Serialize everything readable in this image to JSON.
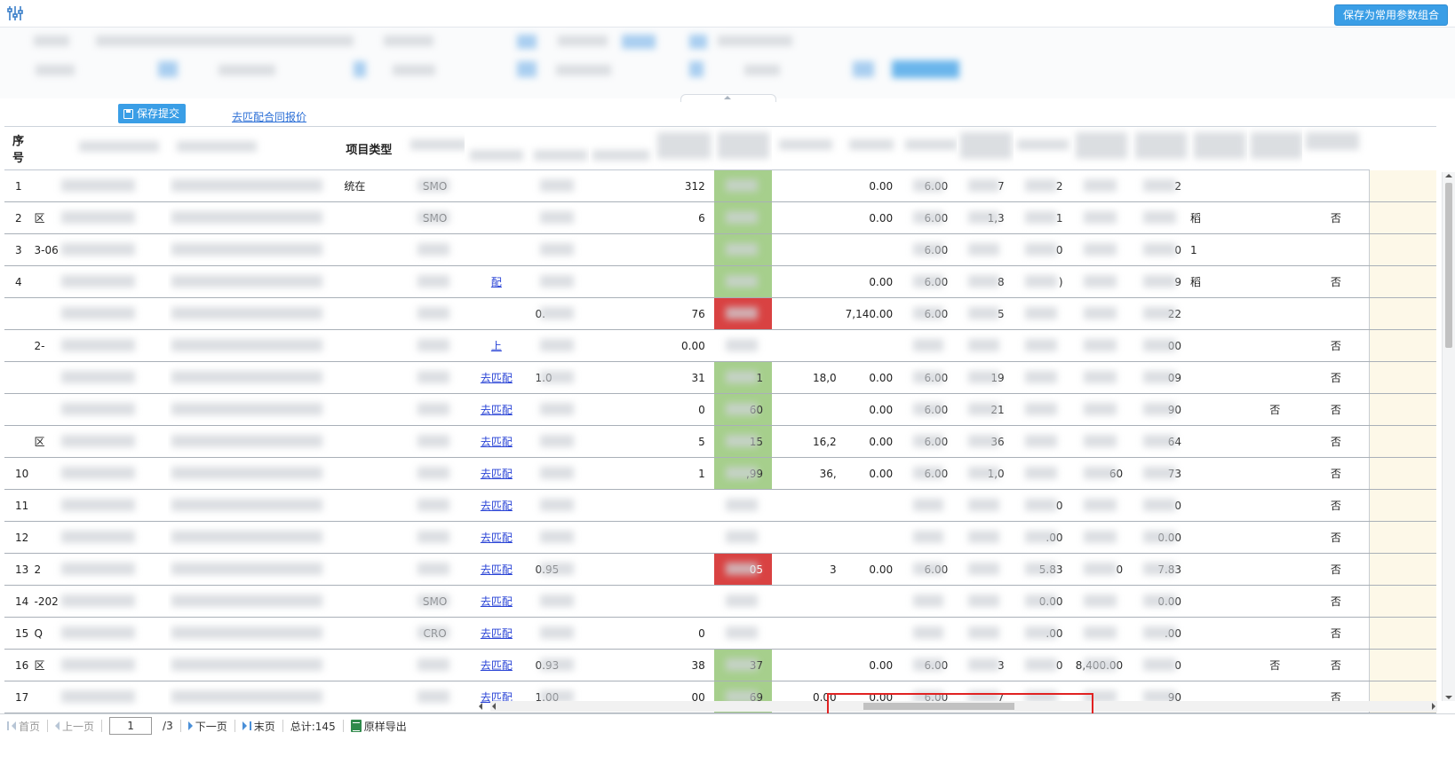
{
  "toolbar": {
    "filter_icon": "sliders-icon",
    "save_combo_label": "保存为常用参数组合"
  },
  "actions": {
    "save_submit_label": "保存提交",
    "match_contract_link": "去匹配合同报价"
  },
  "table": {
    "headers": {
      "index": "序号",
      "project_type": "项目类型"
    },
    "rows": [
      {
        "idx": "1",
        "c1": "",
        "c3": "统在",
        "type": "SMO",
        "match": "",
        "c5": "",
        "c7": "312",
        "c8": "",
        "c9": "",
        "c10": "0.00",
        "c11": "6.00",
        "c12": "7",
        "c13": "2",
        "c14": "",
        "c15": "2",
        "c16": "",
        "c17": "",
        "c18": "",
        "green": true,
        "red": false
      },
      {
        "idx": "2",
        "c1": "区",
        "c3": "",
        "type": "SMO",
        "match": "",
        "c5": "",
        "c7": "6",
        "c8": "",
        "c9": "",
        "c10": "0.00",
        "c11": "6.00",
        "c12": "1,3",
        "c13": "1",
        "c14": "",
        "c15": "",
        "c16": "稻",
        "c17": "",
        "c18": "否",
        "green": true,
        "red": false
      },
      {
        "idx": "3",
        "c1": "3-06",
        "c3": "",
        "type": "",
        "match": "",
        "c5": "",
        "c7": "",
        "c8": "",
        "c9": "",
        "c10": "",
        "c11": "6.00",
        "c12": "",
        "c13": "0",
        "c14": "",
        "c15": "0",
        "c16": "1",
        "c17": "",
        "c18": "",
        "green": true,
        "red": false
      },
      {
        "idx": "4",
        "c1": "",
        "c3": "",
        "type": "",
        "match": "配",
        "c5": "",
        "c7": "",
        "c8": "",
        "c9": "",
        "c10": "0.00",
        "c11": "6.00",
        "c12": "8",
        "c13": ")",
        "c14": "",
        "c15": "9",
        "c16": "稻",
        "c17": "",
        "c18": "否",
        "green": true,
        "red": false
      },
      {
        "idx": "",
        "c1": "",
        "c3": "",
        "type": "",
        "match": "",
        "c5": "0.",
        "c7": "76",
        "c8": "",
        "c9": "",
        "c10": "7,140.00",
        "c11": "6.00",
        "c12": "5",
        "c13": "",
        "c14": "",
        "c15": "22",
        "c16": "",
        "c17": "",
        "c18": "",
        "green": false,
        "red": true
      },
      {
        "idx": "",
        "c1": "2-",
        "c3": "",
        "type": "",
        "match": "上",
        "c5": "",
        "c7": "0.00",
        "c8": "",
        "c9": "",
        "c10": "",
        "c11": "",
        "c12": "",
        "c13": "",
        "c14": "",
        "c15": "00",
        "c16": "",
        "c17": "",
        "c18": "否",
        "green": false,
        "red": false
      },
      {
        "idx": "",
        "c1": "",
        "c3": "",
        "type": "",
        "match": "去匹配",
        "c5": "1.0",
        "c7": "31",
        "c8": "1",
        "c9": "18,0",
        "c10": "0.00",
        "c11": "6.00",
        "c12": "19",
        "c13": "",
        "c14": "",
        "c15": "09",
        "c16": "",
        "c17": "",
        "c18": "否",
        "green": true,
        "red": false
      },
      {
        "idx": "",
        "c1": "",
        "c3": "",
        "type": "",
        "match": "去匹配",
        "c5": "",
        "c7": "0",
        "c8": "60",
        "c9": "",
        "c10": "0.00",
        "c11": "6.00",
        "c12": "21",
        "c13": "",
        "c14": "",
        "c15": "90",
        "c16": "",
        "c17": "否",
        "c18": "否",
        "green": true,
        "red": false
      },
      {
        "idx": "",
        "c1": "区",
        "c3": "",
        "type": "",
        "match": "去匹配",
        "c5": "",
        "c7": "5",
        "c8": "15",
        "c9": "16,2",
        "c10": "0.00",
        "c11": "6.00",
        "c12": "36",
        "c13": "",
        "c14": "",
        "c15": "64",
        "c16": "",
        "c17": "",
        "c18": "否",
        "green": true,
        "red": false
      },
      {
        "idx": "10",
        "c1": "",
        "c3": "",
        "type": "",
        "match": "去匹配",
        "c5": "",
        "c7": "1",
        "c8": ",99",
        "c9": "36,",
        "c10": "0.00",
        "c11": "6.00",
        "c12": "1,0",
        "c13": "",
        "c14": "60",
        "c15": "73",
        "c16": "",
        "c17": "",
        "c18": "否",
        "green": true,
        "red": false
      },
      {
        "idx": "11",
        "c1": "",
        "c3": "",
        "type": "",
        "match": "去匹配",
        "c5": "",
        "c7": "",
        "c8": "",
        "c9": "",
        "c10": "",
        "c11": "",
        "c12": "",
        "c13": "0",
        "c14": "",
        "c15": "0",
        "c16": "",
        "c17": "",
        "c18": "否",
        "green": false,
        "red": false
      },
      {
        "idx": "12",
        "c1": "",
        "c3": "",
        "type": "",
        "match": "去匹配",
        "c5": "",
        "c7": "",
        "c8": "",
        "c9": "",
        "c10": "",
        "c11": "",
        "c12": "",
        "c13": ".00",
        "c14": "",
        "c15": "0.00",
        "c16": "",
        "c17": "",
        "c18": "否",
        "green": false,
        "red": false
      },
      {
        "idx": "13",
        "c1": "2",
        "c3": "",
        "type": "",
        "match": "去匹配",
        "c5": "0.95",
        "c7": "",
        "c8": "05",
        "c9": "3",
        "c10": "0.00",
        "c11": "6.00",
        "c12": "",
        "c13": "5.83",
        "c14": "0",
        "c15": "7.83",
        "c16": "",
        "c17": "",
        "c18": "否",
        "green": false,
        "red": true
      },
      {
        "idx": "14",
        "c1": "-202",
        "c3": "",
        "type": "SMO",
        "match": "去匹配",
        "c5": "",
        "c7": "",
        "c8": "",
        "c9": "",
        "c10": "",
        "c11": "",
        "c12": "",
        "c13": "0.00",
        "c14": "",
        "c15": "0.00",
        "c16": "",
        "c17": "",
        "c18": "否",
        "green": false,
        "red": false
      },
      {
        "idx": "15",
        "c1": "Q",
        "c3": "",
        "type": "CRO",
        "match": "去匹配",
        "c5": "",
        "c7": "0",
        "c8": "",
        "c9": "",
        "c10": "",
        "c11": "",
        "c12": "",
        "c13": ".00",
        "c14": "",
        "c15": ".00",
        "c16": "",
        "c17": "",
        "c18": "否",
        "green": false,
        "red": false
      },
      {
        "idx": "16",
        "c1": "区",
        "c3": "",
        "type": "",
        "match": "去匹配",
        "c5": "0.93",
        "c7": "38",
        "c8": "37",
        "c9": "",
        "c10": "0.00",
        "c11": "6.00",
        "c12": "3",
        "c13": "0",
        "c14": "8,400.00",
        "c15": "0",
        "c16": "",
        "c17": "否",
        "c18": "否",
        "green": true,
        "red": false
      },
      {
        "idx": "17",
        "c1": "",
        "c3": "",
        "type": "",
        "match": "去匹配",
        "c5": "1.00",
        "c7": "00",
        "c8": "69",
        "c9": "0.00",
        "c10": "0.00",
        "c11": "6.00",
        "c12": "7",
        "c13": "",
        "c14": "",
        "c15": "90",
        "c16": "",
        "c17": "",
        "c18": "否",
        "green": true,
        "red": false
      }
    ]
  },
  "pager": {
    "first": "首页",
    "prev": "上一页",
    "current_page": "1",
    "total_pages": "/3",
    "next": "下一页",
    "last": "末页",
    "total": "总计:145",
    "export": "原样导出"
  }
}
